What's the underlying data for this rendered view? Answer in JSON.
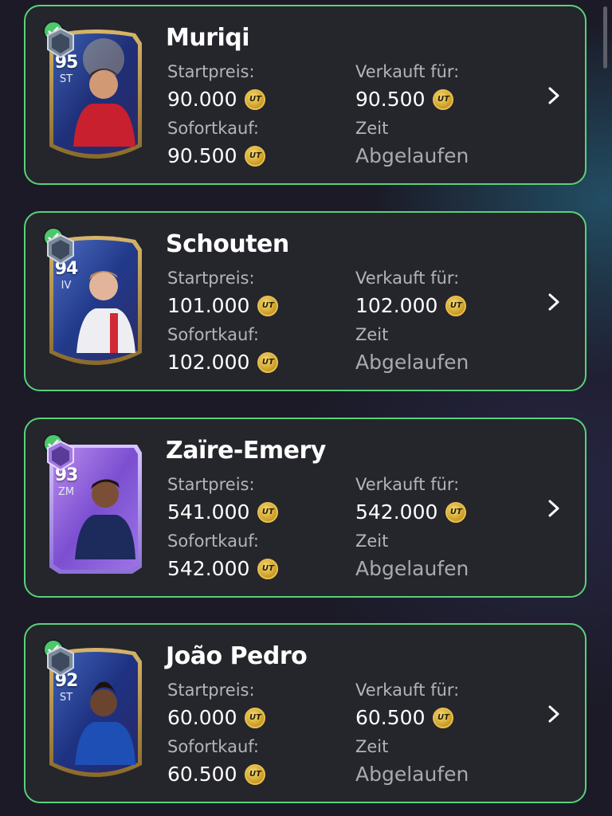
{
  "labels": {
    "start_price": "Startpreis:",
    "sold_for": "Verkauft für:",
    "buy_now": "Sofortkauf:",
    "time": "Zeit"
  },
  "listings": [
    {
      "name": "Muriqi",
      "rating": "95",
      "position": "ST",
      "start_price": "90.000",
      "sold_for": "90.500",
      "buy_now": "90.500",
      "time_value": "Abgelaufen",
      "card_theme": "blue-gold"
    },
    {
      "name": "Schouten",
      "rating": "94",
      "position": "IV",
      "start_price": "101.000",
      "sold_for": "102.000",
      "buy_now": "102.000",
      "time_value": "Abgelaufen",
      "card_theme": "blue-gold"
    },
    {
      "name": "Zaïre-Emery",
      "rating": "93",
      "position": "ZM",
      "start_price": "541.000",
      "sold_for": "542.000",
      "buy_now": "542.000",
      "time_value": "Abgelaufen",
      "card_theme": "purple"
    },
    {
      "name": "João Pedro",
      "rating": "92",
      "position": "ST",
      "start_price": "60.000",
      "sold_for": "60.500",
      "buy_now": "60.500",
      "time_value": "Abgelaufen",
      "card_theme": "blue-gold"
    }
  ],
  "icons": {
    "coin": "ut-coin-icon",
    "chevron": "chevron-right-icon",
    "status": "sold-check-icon"
  },
  "colors": {
    "accent_border": "#59d17a",
    "check_green": "#4cc86b",
    "panel": "#25252c",
    "coin_gold": "#d9ad36"
  }
}
